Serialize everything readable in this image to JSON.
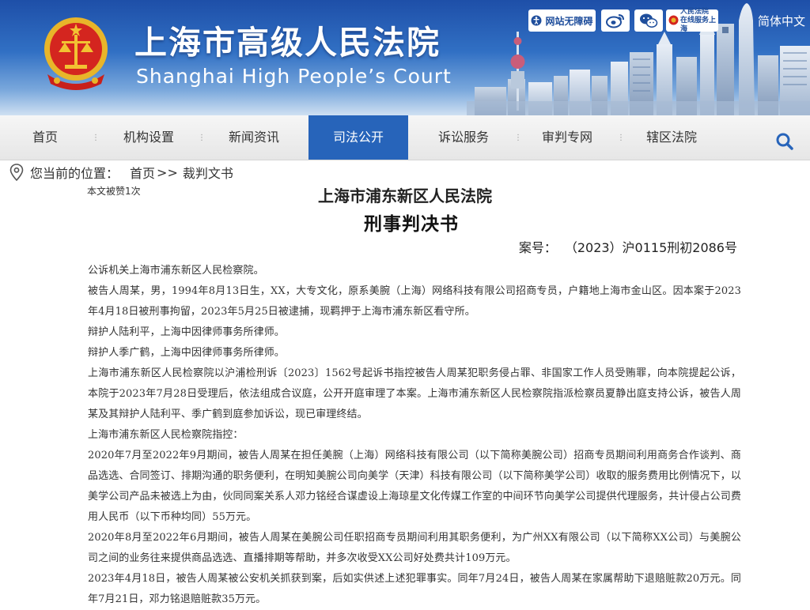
{
  "header": {
    "court_name_cn": "上海市高级人民法院",
    "court_name_en": "Shanghai High People’s Court",
    "accessibility_label": "网站无障碍",
    "online_service_line1": "人民法院",
    "online_service_line2": "在线服务上海",
    "language_label": "简体中文",
    "brand_color": "#2764ba"
  },
  "nav": {
    "items": [
      {
        "label": "首页"
      },
      {
        "label": "机构设置"
      },
      {
        "label": "新闻资讯"
      },
      {
        "label": "司法公开",
        "active": true
      },
      {
        "label": "诉讼服务"
      },
      {
        "label": "审判专网"
      },
      {
        "label": "辖区法院"
      }
    ],
    "search_icon": "search-icon"
  },
  "breadcrumb": {
    "prefix": "您当前的位置：",
    "home": "首页",
    "separator": ">>",
    "current": "裁判文书"
  },
  "document": {
    "likes": "本文被赞1次",
    "court": "上海市浦东新区人民法院",
    "type": "刑事判决书",
    "case_label": "案号：",
    "case_number": "（2023）沪0115刑初2086号",
    "paragraphs": [
      "公诉机关上海市浦东新区人民检察院。",
      "被告人周某，男，1994年8月13日生，XX，大专文化，原系美腕（上海）网络科技有限公司招商专员，户籍地上海市金山区。因本案于2023年4月18日被刑事拘留，2023年5月25日被逮捕，现羁押于上海市浦东新区看守所。",
      "辩护人陆利平，上海中因律师事务所律师。",
      "辩护人季广鹤，上海中因律师事务所律师。",
      "上海市浦东新区人民检察院以沪浦检刑诉〔2023〕1562号起诉书指控被告人周某犯职务侵占罪、非国家工作人员受贿罪，向本院提起公诉，本院于2023年7月28日受理后，依法组成合议庭，公开开庭审理了本案。上海市浦东新区人民检察院指派检察员夏静出庭支持公诉，被告人周某及其辩护人陆利平、季广鹤到庭参加诉讼，现已审理终结。",
      "上海市浦东新区人民检察院指控：",
      "2020年7月至2022年9月期间，被告人周某在担任美腕（上海）网络科技有限公司（以下简称美腕公司）招商专员期间利用商务合作谈判、商品选选、合同签订、排期沟通的职务便利，在明知美腕公司向美学（天津）科技有限公司（以下简称美学公司）收取的服务费用比例情况下，以美学公司产品未被选上为由，伙同同案关系人邓力铭经合谋虚设上海琼星文化传媒工作室的中间环节向美学公司提供代理服务，共计侵占公司费用人民币（以下币种均同）55万元。",
      "2020年8月至2022年6月期间，被告人周某在美腕公司任职招商专员期间利用其职务便利，为广州XX有限公司（以下简称XX公司）与美腕公司之间的业务往来提供商品选选、直播排期等帮助，并多次收受XX公司好处费共计109万元。",
      "2023年4月18日，被告人周某被公安机关抓获到案，后如实供述上述犯罪事实。同年7月24日，被告人周某在家属帮助下退赔赃款20万元。同年7月21日，邓力铭退赔赃款35万元。"
    ]
  }
}
